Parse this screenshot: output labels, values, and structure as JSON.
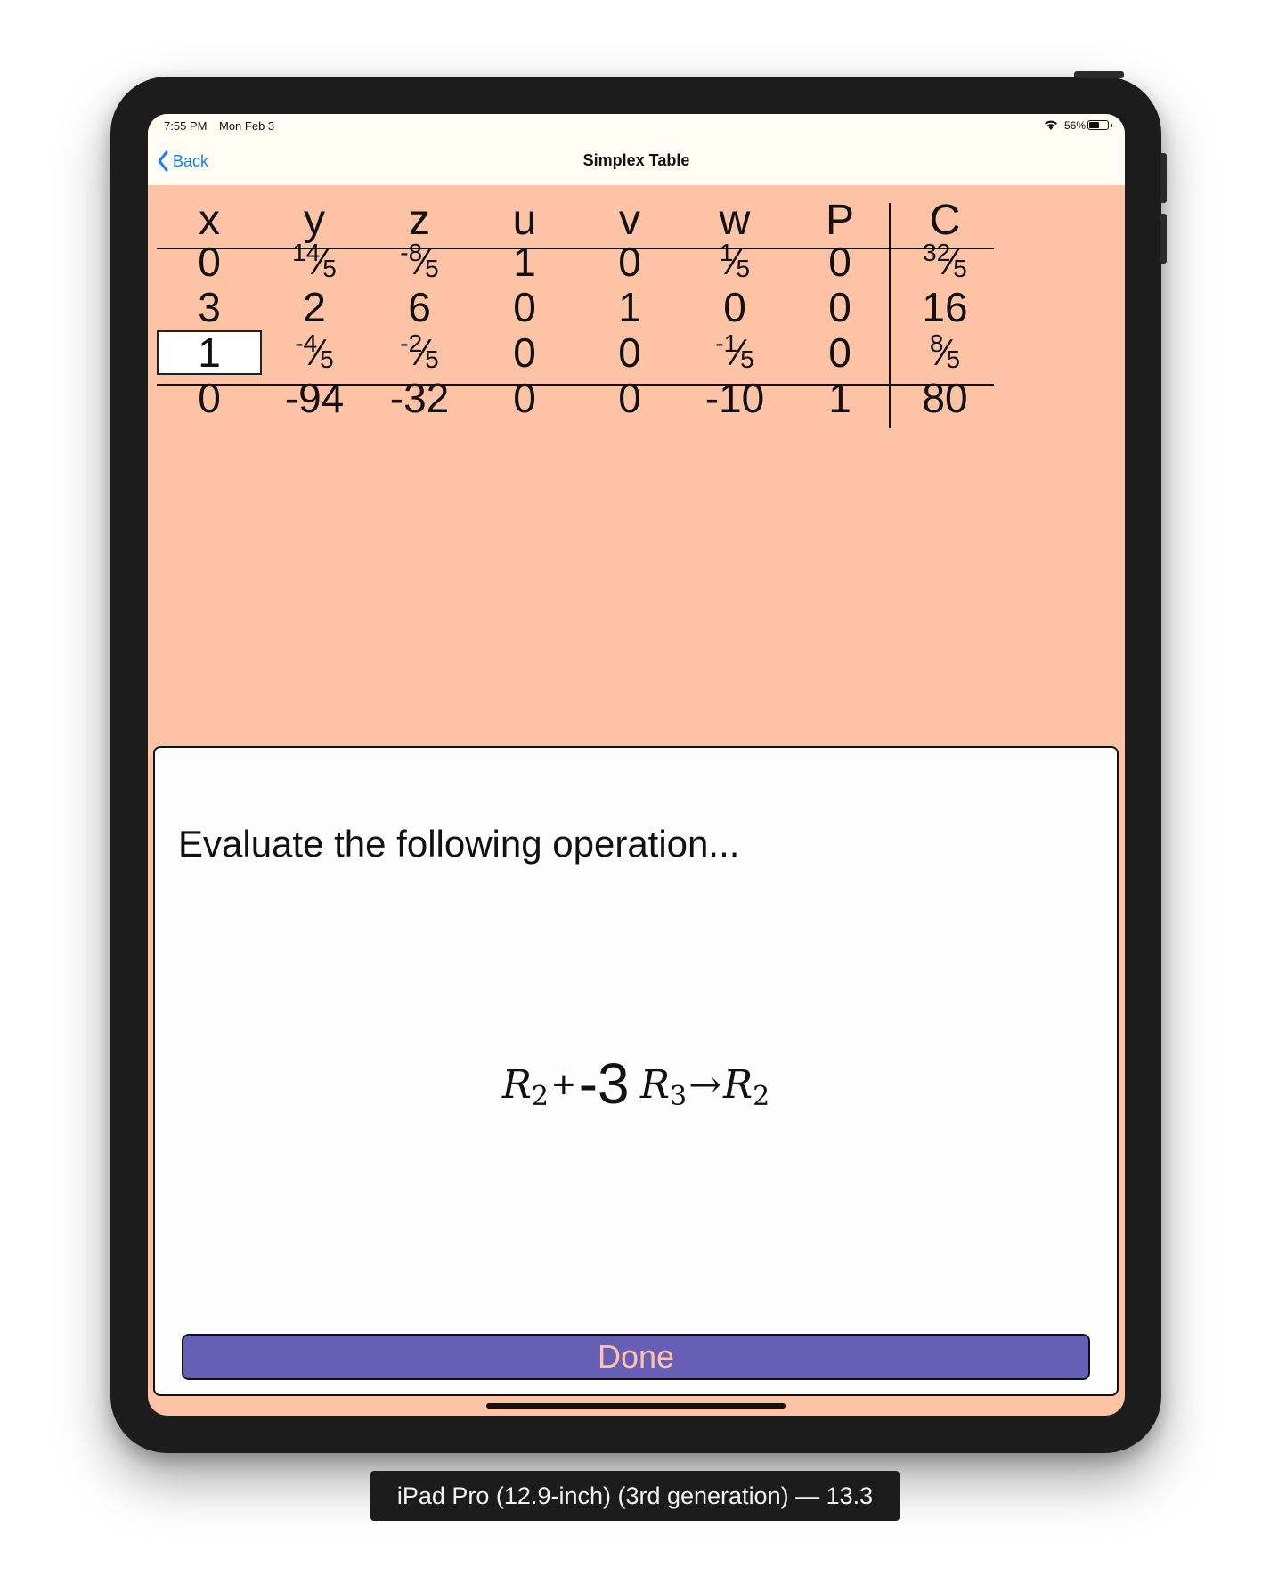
{
  "status_bar": {
    "time": "7:55 PM",
    "date": "Mon Feb 3",
    "battery": "56%",
    "battery_level": 0.56
  },
  "nav": {
    "back_label": "Back",
    "title": "Simplex Table"
  },
  "tableau": {
    "headers": [
      "x",
      "y",
      "z",
      "u",
      "v",
      "w",
      "P",
      "C"
    ],
    "rows": [
      [
        "0",
        {
          "n": "14",
          "d": "5"
        },
        {
          "n": "-8",
          "d": "5"
        },
        "1",
        "0",
        {
          "n": "1",
          "d": "5"
        },
        "0",
        {
          "n": "32",
          "d": "5"
        }
      ],
      [
        "3",
        "2",
        "6",
        "0",
        "1",
        "0",
        "0",
        "16"
      ],
      [
        "1",
        {
          "n": "-4",
          "d": "5"
        },
        {
          "n": "-2",
          "d": "5"
        },
        "0",
        "0",
        {
          "n": "-1",
          "d": "5"
        },
        "0",
        {
          "n": "8",
          "d": "5"
        }
      ],
      [
        "0",
        "-94",
        "-32",
        "0",
        "0",
        "-10",
        "1",
        "80"
      ]
    ],
    "highlight": {
      "row": 2,
      "col": 0
    }
  },
  "panel": {
    "prompt": "Evaluate the following operation...",
    "equation": {
      "target_var": "R",
      "target_sub": "2",
      "plus": "+",
      "scalar": "-3",
      "source_var": "R",
      "source_sub": "3",
      "arrow": "→",
      "result_var": "R",
      "result_sub": "2"
    },
    "done_label": "Done"
  },
  "device_label": "iPad Pro (12.9-inch) (3rd generation) — 13.3",
  "colors": {
    "background": "#fec3a5",
    "button": "#665fb5",
    "button_text": "#fec3a5",
    "link": "#147efb"
  }
}
